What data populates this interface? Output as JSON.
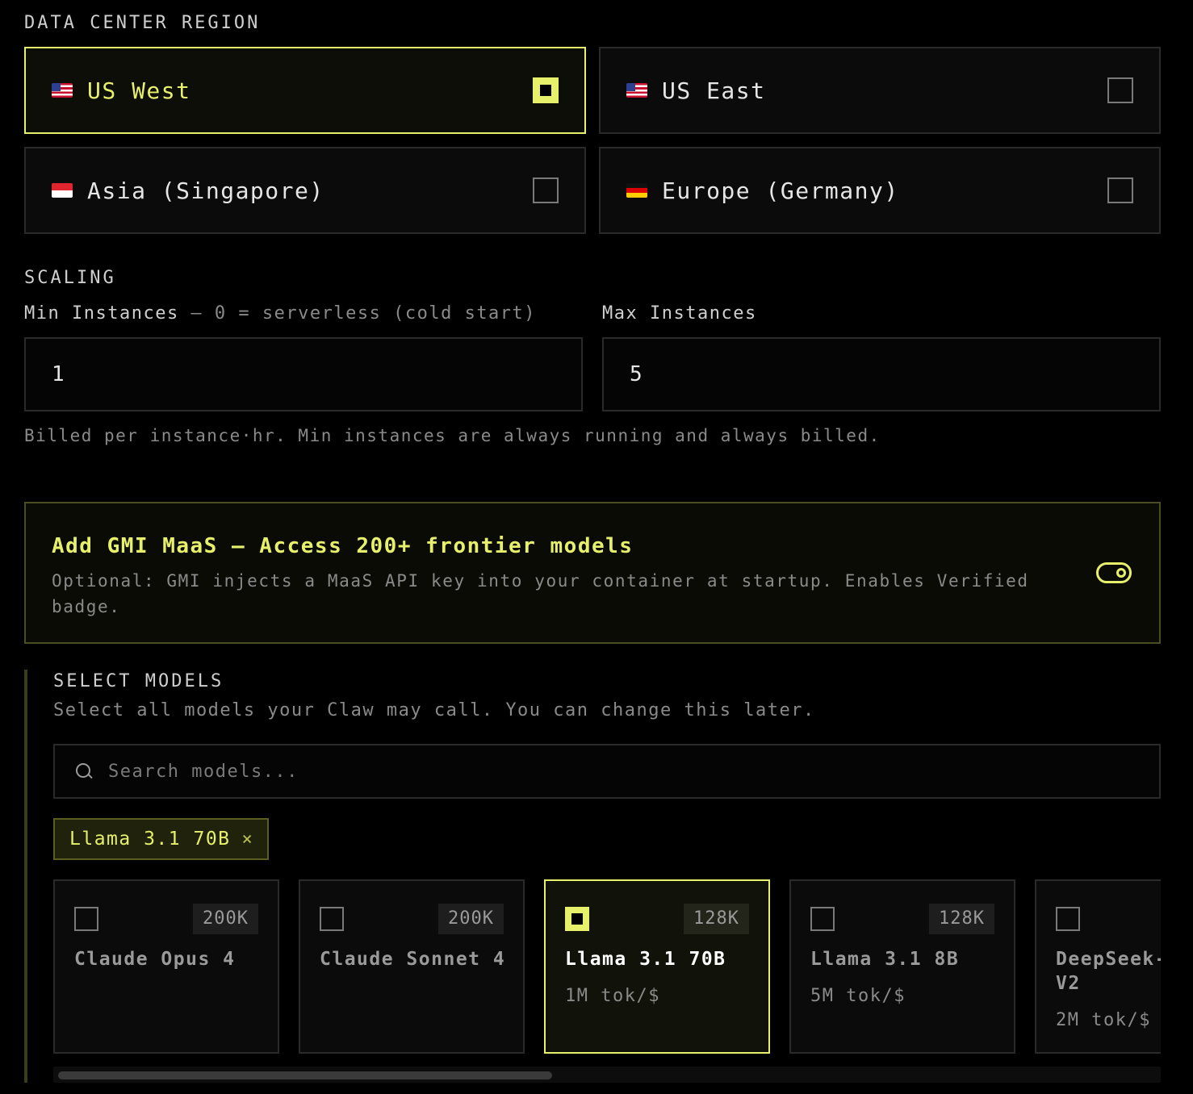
{
  "region": {
    "label": "DATA CENTER REGION",
    "options": [
      {
        "name": "US West",
        "flag": "us-flag-icon",
        "selected": true
      },
      {
        "name": "US East",
        "flag": "us-flag-icon",
        "selected": false
      },
      {
        "name": "Asia (Singapore)",
        "flag": "singapore-flag-icon",
        "selected": false
      },
      {
        "name": "Europe (Germany)",
        "flag": "germany-flag-icon",
        "selected": false
      }
    ]
  },
  "scaling": {
    "label": "SCALING",
    "min_label": "Min Instances",
    "min_hint": " — 0 = serverless (cold start)",
    "min_value": "1",
    "max_label": "Max Instances",
    "max_value": "5",
    "note": "Billed per instance·hr. Min instances are always running and always billed."
  },
  "maas": {
    "title": "Add GMI MaaS — Access 200+ frontier models",
    "description": "Optional: GMI injects a MaaS API key into your container at startup. Enables Verified badge.",
    "enabled": true
  },
  "models": {
    "label": "SELECT MODELS",
    "subtitle": "Select all models your Claw may call. You can change this later.",
    "search_placeholder": "Search models...",
    "search_value": "",
    "chips": [
      {
        "label": "Llama 3.1 70B",
        "remove": "×"
      }
    ],
    "cards": [
      {
        "name": "Claude Opus 4",
        "context": "200K",
        "price": "",
        "selected": false
      },
      {
        "name": "Claude Sonnet 4",
        "context": "200K",
        "price": "",
        "selected": false
      },
      {
        "name": "Llama 3.1 70B",
        "context": "128K",
        "price": "1M tok/$",
        "selected": true
      },
      {
        "name": "Llama 3.1 8B",
        "context": "128K",
        "price": "5M tok/$",
        "selected": false
      },
      {
        "name": "DeepSeek-V2",
        "context": "",
        "price": "2M tok/$",
        "selected": false
      }
    ]
  },
  "colors": {
    "accent": "#e6f06b",
    "background": "#000000",
    "card": "#0b0b0b",
    "border": "#2a2a2a"
  }
}
